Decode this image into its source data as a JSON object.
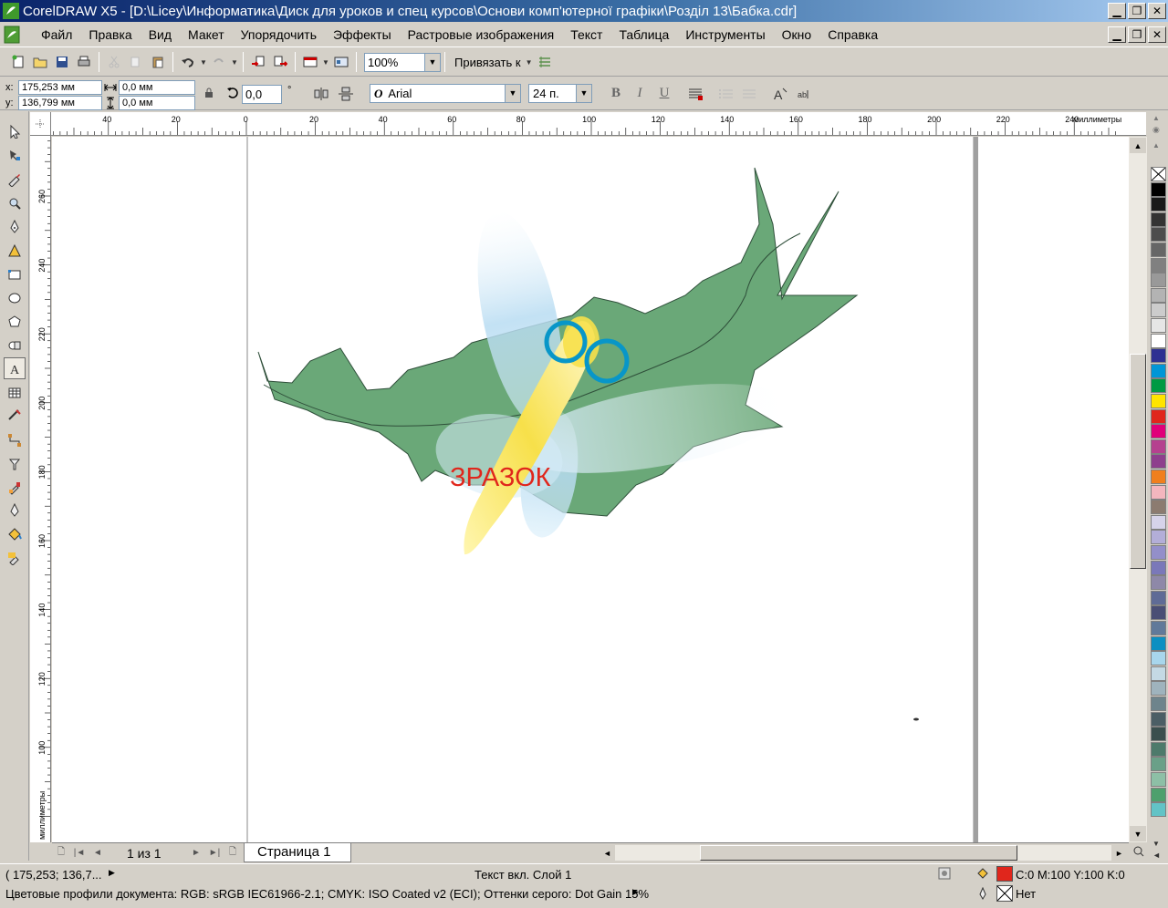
{
  "window": {
    "title": "CorelDRAW X5 - [D:\\Licey\\Информатика\\Диск для уроков и спец курсов\\Основи комп'ютерної графіки\\Розділ 13\\Бабка.cdr]"
  },
  "menu": {
    "items": [
      {
        "label": "Файл"
      },
      {
        "label": "Правка"
      },
      {
        "label": "Вид"
      },
      {
        "label": "Макет"
      },
      {
        "label": "Упорядочить"
      },
      {
        "label": "Эффекты"
      },
      {
        "label": "Растровые изображения"
      },
      {
        "label": "Текст"
      },
      {
        "label": "Таблица"
      },
      {
        "label": "Инструменты"
      },
      {
        "label": "Окно"
      },
      {
        "label": "Справка"
      }
    ]
  },
  "toolbar": {
    "zoom_value": "100%",
    "snap_label": "Привязать к"
  },
  "propertybar": {
    "x_label": "x:",
    "x_value": "175,253 мм",
    "y_label": "y:",
    "y_value": "136,799 мм",
    "width_value": "0,0 мм",
    "height_value": "0,0 мм",
    "rotation_value": "0,0",
    "rotation_unit": "°",
    "font_name": "Arial",
    "font_size": "24 п."
  },
  "rulers": {
    "unit_label": "миллиметры",
    "h_ticks": [
      "40",
      "20",
      "0",
      "20",
      "40",
      "60",
      "80",
      "100",
      "120",
      "140",
      "160",
      "180",
      "200",
      "220",
      "240"
    ],
    "v_ticks": [
      "260",
      "240",
      "220",
      "200",
      "180",
      "160",
      "140",
      "120",
      "100"
    ]
  },
  "canvas": {
    "artwork_text": "ЗРАЗОК"
  },
  "pagebar": {
    "page_count": "1 из 1",
    "page_tab": "Страница 1"
  },
  "status": {
    "cursor_coords": "( 175,253; 136,7...",
    "object_info": "Текст вкл. Слой 1",
    "fill_label": "C:0 M:100 Y:100 K:0",
    "outline_label": "Нет",
    "color_profiles": "Цветовые профили документа: RGB: sRGB IEC61966-2.1; CMYK: ISO Coated v2 (ECI); Оттенки серого: Dot Gain 15%"
  },
  "colors": {
    "title_gradient_start": "#0a246a",
    "leaf_green": "#6aa878",
    "artwork_text_red": "#e0261c",
    "ring_blue": "#0896c8",
    "fill_swatch": "#e0261c",
    "palette": [
      "#ffffff",
      "#000000",
      "#1a1a1a",
      "#333333",
      "#4d4d4d",
      "#666666",
      "#808080",
      "#999999",
      "#b3b3b3",
      "#cccccc",
      "#e6e6e6",
      "#ffffff",
      "#2e3192",
      "#0096d6",
      "#009a44",
      "#ffe400",
      "#e0261c",
      "#e0007a",
      "#b5418f",
      "#8e3f8d",
      "#f07f1e",
      "#f4b6be",
      "#8c7b70",
      "#d6d3ea",
      "#b3aed8",
      "#938fca",
      "#7a78b9",
      "#8e88a8",
      "#5f6b96",
      "#4a4e75",
      "#61799a",
      "#0c8fc2",
      "#a8d6ec",
      "#c4d9e4",
      "#9fb3bd",
      "#6e848c",
      "#4b5e65",
      "#3a4f4e",
      "#4d7a6b",
      "#6aa088",
      "#8dbfa6",
      "#4ea06d",
      "#62c3c6"
    ]
  }
}
